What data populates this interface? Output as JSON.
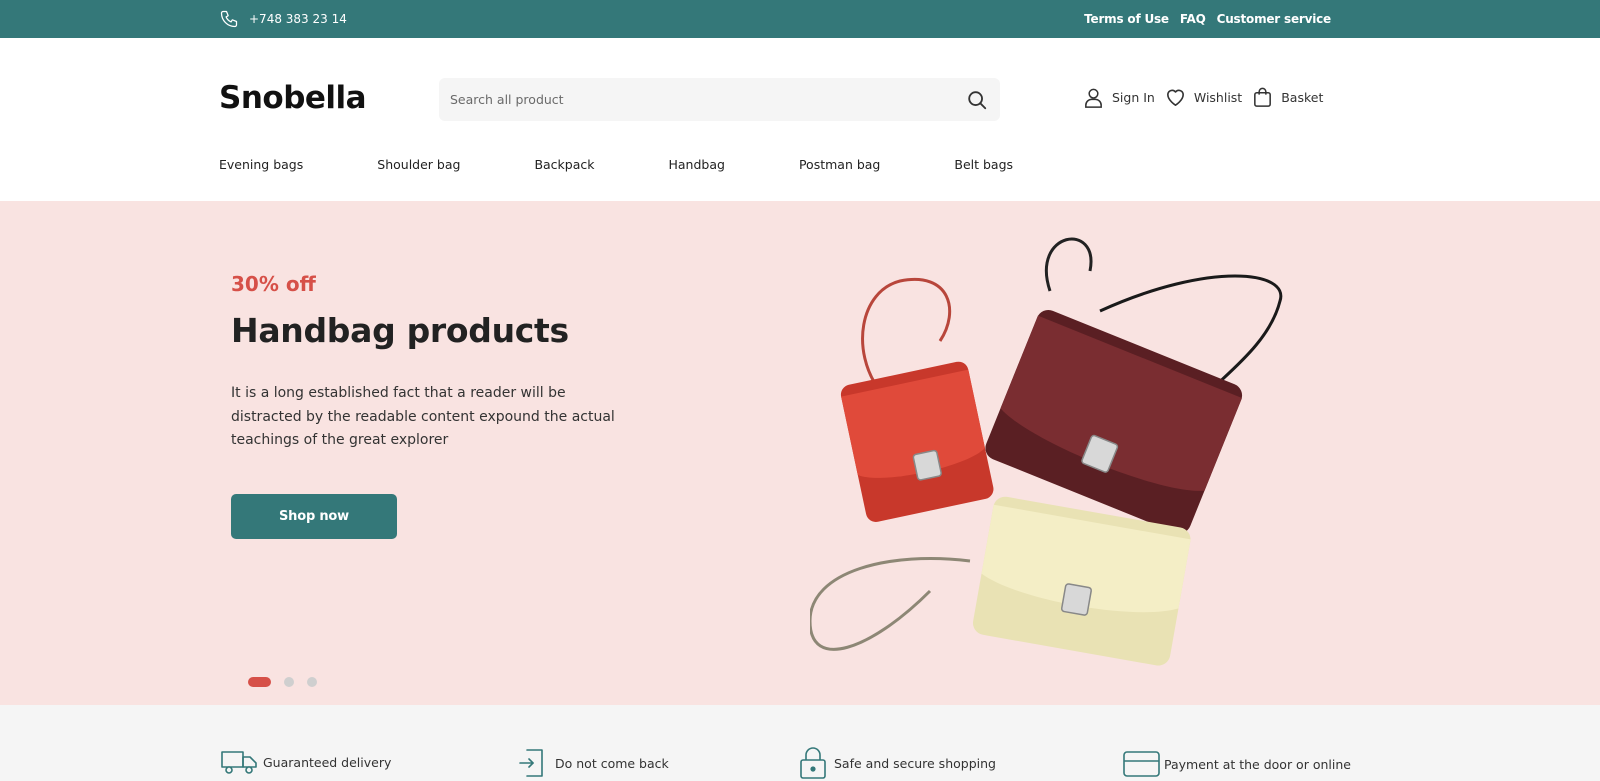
{
  "topbar": {
    "phone": "+748 383 23 14",
    "links": [
      "Terms of Use",
      "FAQ",
      "Customer service"
    ]
  },
  "header": {
    "logo": "Snobella",
    "search_placeholder": "Search all product",
    "actions": [
      {
        "label": "Sign In",
        "icon": "user-icon"
      },
      {
        "label": "Wishlist",
        "icon": "heart-icon"
      },
      {
        "label": "Basket",
        "icon": "shopping-bag-icon"
      }
    ]
  },
  "categories": [
    "Evening bags",
    "Shoulder bag",
    "Backpack",
    "Handbag",
    "Postman bag",
    "Belt bags"
  ],
  "hero": {
    "promo": "30% off",
    "title": "Handbag products",
    "description": "It is a long established fact that a reader will be distracted by the readable content expound the actual teachings of the great explorer",
    "cta": "Shop now",
    "slides": 3,
    "active_slide": 1
  },
  "features": [
    {
      "label": "Guaranteed delivery",
      "icon": "truck-icon"
    },
    {
      "label": "Do not come back",
      "icon": "return-icon"
    },
    {
      "label": "Safe and secure shopping",
      "icon": "lock-icon"
    },
    {
      "label": "Payment at the door or online",
      "icon": "credit-card-icon"
    }
  ],
  "colors": {
    "brand": "#347879",
    "accent": "#d65048",
    "hero_bg": "#f9e3e1"
  }
}
